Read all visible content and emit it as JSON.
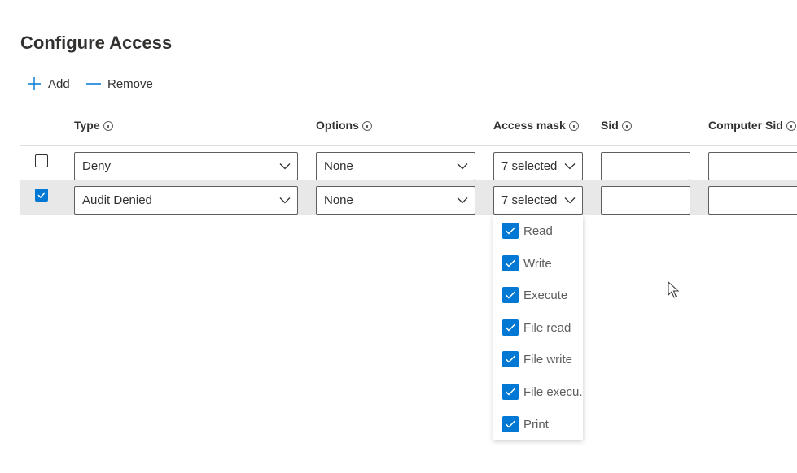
{
  "page": {
    "title": "Configure Access"
  },
  "toolbar": {
    "add_label": "Add",
    "remove_label": "Remove"
  },
  "columns": {
    "type": "Type",
    "options": "Options",
    "access_mask": "Access mask",
    "sid": "Sid",
    "computer_sid": "Computer Sid"
  },
  "rows": [
    {
      "checked": false,
      "type": "Deny",
      "options": "None",
      "access_mask": "7 selected",
      "sid": "",
      "computer_sid": ""
    },
    {
      "checked": true,
      "type": "Audit Denied",
      "options": "None",
      "access_mask": "7 selected",
      "sid": "",
      "computer_sid": ""
    }
  ],
  "access_mask_menu": {
    "options": [
      {
        "label": "Read",
        "checked": true
      },
      {
        "label": "Write",
        "checked": true
      },
      {
        "label": "Execute",
        "checked": true
      },
      {
        "label": "File read",
        "checked": true
      },
      {
        "label": "File write",
        "checked": true
      },
      {
        "label": "File execu...",
        "checked": true
      },
      {
        "label": "Print",
        "checked": true
      }
    ]
  },
  "colors": {
    "accent": "#0078d4",
    "text": "#323130",
    "selected_row": "#e8e8e8",
    "border": "#605e5c"
  }
}
